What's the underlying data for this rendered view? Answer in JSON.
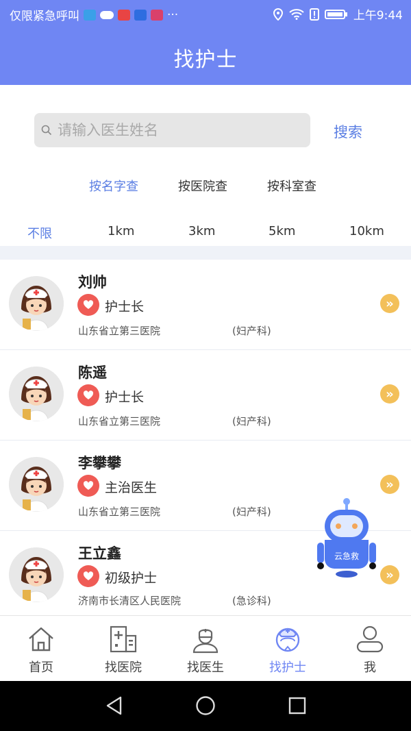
{
  "status_bar": {
    "carrier": "仅限紧急呼叫",
    "time": "上午9:44",
    "more": "···"
  },
  "header": {
    "title": "找护士"
  },
  "search": {
    "placeholder": "请输入医生姓名",
    "button_label": "搜索"
  },
  "query_tabs": [
    {
      "label": "按名字查",
      "active": true
    },
    {
      "label": "按医院查",
      "active": false
    },
    {
      "label": "按科室查",
      "active": false
    }
  ],
  "distance_tabs": [
    {
      "label": "不限",
      "active": true
    },
    {
      "label": "1km",
      "active": false
    },
    {
      "label": "3km",
      "active": false
    },
    {
      "label": "5km",
      "active": false
    },
    {
      "label": "10km",
      "active": false
    }
  ],
  "nurses": [
    {
      "name": "刘帅",
      "title": "护士长",
      "hospital": "山东省立第三医院",
      "department": "(妇产科)"
    },
    {
      "name": "陈遥",
      "title": "护士长",
      "hospital": "山东省立第三医院",
      "department": "(妇产科)"
    },
    {
      "name": "李攀攀",
      "title": "主治医生",
      "hospital": "山东省立第三医院",
      "department": "(妇产科)"
    },
    {
      "name": "王立鑫",
      "title": "初级护士",
      "hospital": "济南市长清区人民医院",
      "department": "(急诊科)"
    }
  ],
  "robot": {
    "label": "云急救"
  },
  "tab_bar": [
    {
      "label": "首页",
      "icon": "home-icon",
      "active": false
    },
    {
      "label": "找医院",
      "icon": "hospital-icon",
      "active": false
    },
    {
      "label": "找医生",
      "icon": "doctor-icon",
      "active": false
    },
    {
      "label": "找护士",
      "icon": "nurse-icon",
      "active": true
    },
    {
      "label": "我",
      "icon": "user-icon",
      "active": false
    }
  ],
  "colors": {
    "header": "#6f86f3",
    "accent": "#5a7ee3",
    "heart": "#ef5b55",
    "arrow": "#f3c05a",
    "robot": "#4f79f0"
  }
}
